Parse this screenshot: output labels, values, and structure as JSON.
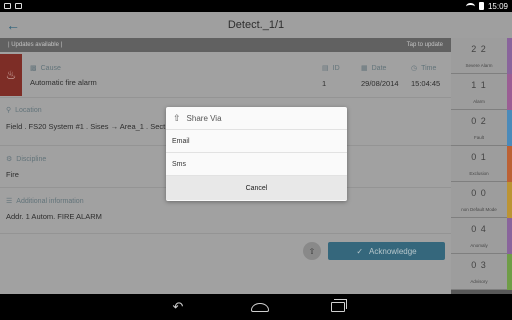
{
  "statusbar": {
    "time": "15:09"
  },
  "appbar": {
    "title": "Detect._1/1",
    "back_icon": "arrow-left-icon"
  },
  "updates": {
    "left": "| Updates available |",
    "right": "Tap to update"
  },
  "cause": {
    "label": "Cause",
    "value": "Automatic fire alarm",
    "id_label": "ID",
    "id_value": "1",
    "date_label": "Date",
    "date_value": "29/08/2014",
    "time_label": "Time",
    "time_value": "15:04:45"
  },
  "location": {
    "label": "Location",
    "value": "Field . FS20 System #1 . Sises → Area_1 . Sect"
  },
  "discipline": {
    "label": "Discipline",
    "value": "Fire"
  },
  "additional": {
    "label": "Additional information",
    "value": "Addr. 1 Autom. FIRE ALARM"
  },
  "acknowledge_label": "Acknowledge",
  "sidebar": [
    {
      "count": "2  2",
      "name": "Severe Alarm",
      "color": "#9a6db1"
    },
    {
      "count": "1  1",
      "name": "Alarm",
      "color": "#b064a8"
    },
    {
      "count": "0  2",
      "name": "Fault",
      "color": "#4d9bd6"
    },
    {
      "count": "0  1",
      "name": "Exclusion",
      "color": "#d86a32"
    },
    {
      "count": "0  0",
      "name": "non Default Mode",
      "color": "#d8a832"
    },
    {
      "count": "0  4",
      "name": "Anomaly",
      "color": "#9a6db1"
    },
    {
      "count": "0  3",
      "name": "Advisory",
      "color": "#7ab34a"
    }
  ],
  "dialog": {
    "title": "Share Via",
    "options": [
      "Email",
      "Sms"
    ],
    "cancel": "Cancel"
  }
}
